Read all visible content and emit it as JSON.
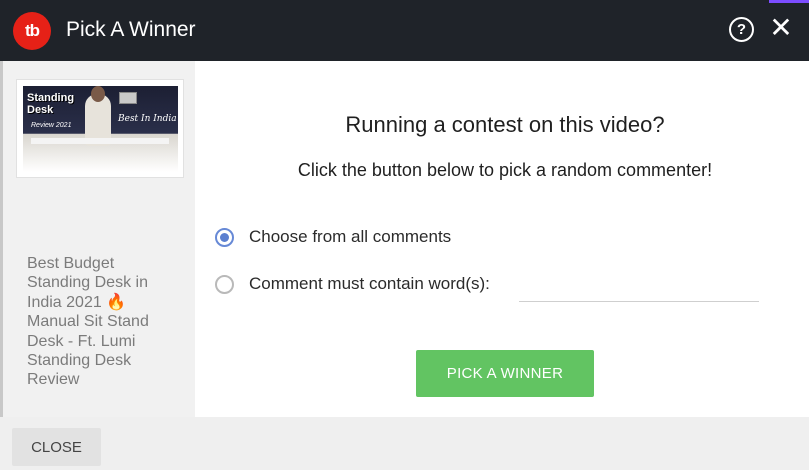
{
  "window": {
    "title": "Pick A Winner",
    "logo_text": "tb",
    "help_icon": "question-circle-icon",
    "close_icon": "close-icon",
    "help_glyph": "?",
    "close_glyph": "✕"
  },
  "sidebar": {
    "thumbnail": {
      "title_line1": "Standing",
      "title_line2": "Desk",
      "subtitle": "Review 2021",
      "badge": "Best In India"
    },
    "video_title": "Best Budget Standing Desk in India 2021 🔥 Manual Sit Stand Desk - Ft. Lumi Standing Desk Review"
  },
  "main": {
    "heading": "Running a contest on this video?",
    "subheading": "Click the button below to pick a random commenter!",
    "options": [
      {
        "label": "Choose from all comments",
        "checked": true
      },
      {
        "label": "Comment must contain word(s):",
        "checked": false
      }
    ],
    "word_input": {
      "value": "",
      "placeholder": ""
    },
    "pick_button_label": "PICK A WINNER"
  },
  "footer": {
    "close_button_label": "CLOSE"
  },
  "colors": {
    "titlebar": "#1f2329",
    "brand_red": "#e62117",
    "pick_green": "#62c462",
    "radio_blue": "#5b7fd0"
  }
}
